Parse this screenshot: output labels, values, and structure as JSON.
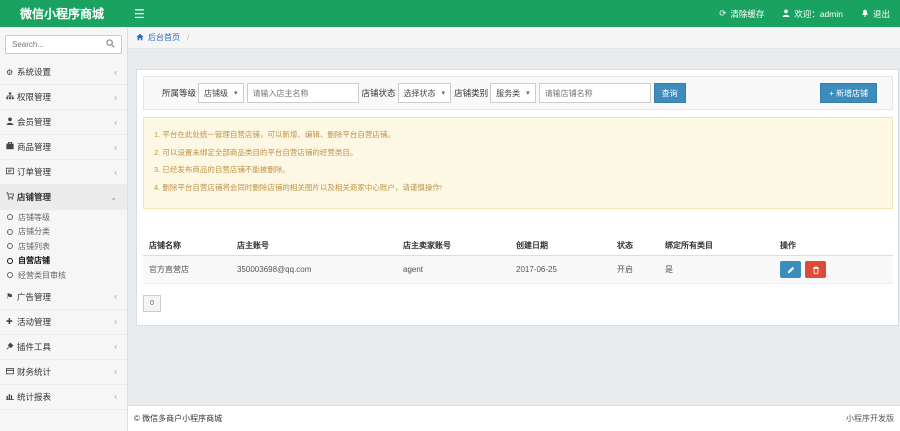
{
  "header": {
    "brand": "微信小程序商城",
    "menu_toggle_icon": "bars-icon",
    "actions": [
      {
        "label": "清除缓存",
        "icon": "refresh-icon"
      },
      {
        "label": "欢迎：admin",
        "icon": "user-icon"
      },
      {
        "label": "退出",
        "icon": "bell-icon"
      }
    ]
  },
  "sidebar": {
    "search_placeholder": "Search...",
    "items": [
      {
        "label": "系统设置",
        "icon": "gear-icon"
      },
      {
        "label": "权限管理",
        "icon": "sitemap-icon"
      },
      {
        "label": "会员管理",
        "icon": "user-icon"
      },
      {
        "label": "商品管理",
        "icon": "product-icon"
      },
      {
        "label": "订单管理",
        "icon": "order-icon"
      },
      {
        "label": "店铺管理",
        "icon": "shop-icon"
      },
      {
        "label": "广告管理",
        "icon": "flag-icon"
      },
      {
        "label": "活动管理",
        "icon": "plus-icon"
      },
      {
        "label": "插件工具",
        "icon": "plug-icon"
      },
      {
        "label": "财务统计",
        "icon": "credit-card-icon"
      },
      {
        "label": "统计报表",
        "icon": "bar-chart-icon"
      }
    ],
    "shop_sub": [
      "店铺等级",
      "店铺分类",
      "店铺列表",
      "自营店铺",
      "经营类目审核"
    ]
  },
  "breadcrumb": {
    "home": "后台首页",
    "sep": "/"
  },
  "filter": {
    "level_label": "所属等级",
    "level_value": "店铺级",
    "owner_placeholder": "请输入店主名称",
    "status_label": "店铺状态",
    "status_value": "选择状态",
    "category_label": "店铺类别",
    "category_value": "服务类",
    "shop_placeholder": "请输店铺名称",
    "query_label": "查询",
    "add_label": "+ 新增店铺"
  },
  "notice": [
    "1. 平台在此处统一管理自营店铺，可以新增、编辑、删除平台自营店铺。",
    "2. 可以设置未绑定全部商品类目的平台自营店铺的经营类目。",
    "3. 已经发布商品的自营店铺不能被删除。",
    "4. 删除平台自营店铺将会同时删除店铺的相关图片以及相关商家中心账户，请谨慎操作!"
  ],
  "table": {
    "headers": [
      "店铺名称",
      "店主账号",
      "店主卖家账号",
      "创建日期",
      "状态",
      "绑定所有类目",
      "操作"
    ],
    "rows": [
      [
        "官方直营店",
        "350003698@qq.com",
        "agent",
        "2017-06-25",
        "开启",
        "是"
      ]
    ]
  },
  "pager": {
    "label": "0"
  },
  "footer": {
    "left": "© 微信多商户小程序商城",
    "right": "小程序开发版"
  }
}
